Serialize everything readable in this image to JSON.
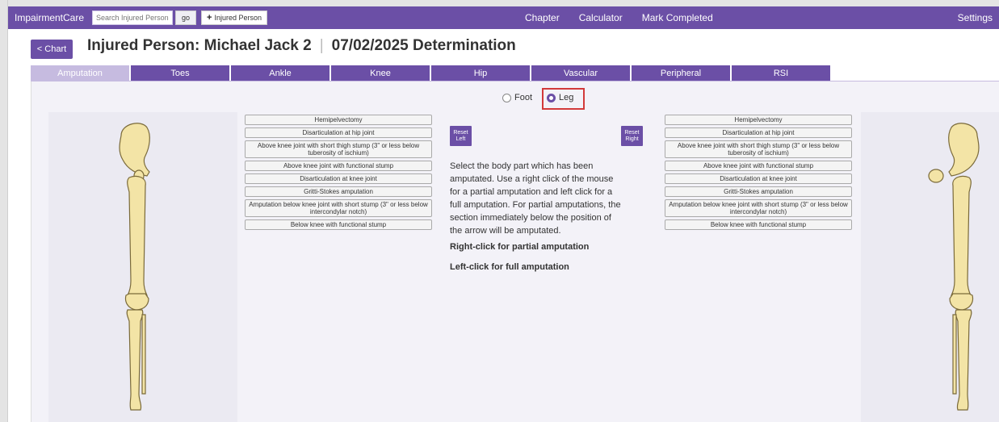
{
  "topbar": {
    "brand": "ImpairmentCare",
    "search_placeholder": "Search Injured Person",
    "go_label": "go",
    "add_label": "Injured Person",
    "nav": [
      "Chapter",
      "Calculator",
      "Mark Completed"
    ],
    "settings": "Settings",
    "color": "#6b4fa6"
  },
  "header": {
    "back_label": "< Chart",
    "person_label": "Injured Person: Michael Jack 2",
    "determination": "07/02/2025 Determination"
  },
  "tabs": [
    {
      "label": "Amputation",
      "active": true
    },
    {
      "label": "Toes",
      "active": false
    },
    {
      "label": "Ankle",
      "active": false
    },
    {
      "label": "Knee",
      "active": false
    },
    {
      "label": "Hip",
      "active": false
    },
    {
      "label": "Vascular",
      "active": false
    },
    {
      "label": "Peripheral",
      "active": false
    },
    {
      "label": "RSI",
      "active": false
    }
  ],
  "selector": {
    "options": [
      "Foot",
      "Leg"
    ],
    "selected": "Leg"
  },
  "amputation_options_left": [
    "Hemipelvectomy",
    "Disarticulation at hip joint",
    "Above knee joint with short thigh stump (3\" or less below tuberosity of ischium)",
    "Above knee joint with functional stump",
    "Disarticulation at knee joint",
    "Gritti-Stokes amputation",
    "Amputation below knee joint with short stump (3\" or less below intercondylar notch)",
    "Below knee with functional stump"
  ],
  "amputation_options_right": [
    "Hemipelvectomy",
    "Disarticulation at hip joint",
    "Above knee joint with short thigh stump (3\" or less below tuberosity of ischium)",
    "Above knee joint with functional stump",
    "Disarticulation at knee joint",
    "Gritti-Stokes amputation",
    "Amputation below knee joint with short stump (3\" or less below intercondylar notch)",
    "Below knee with functional stump"
  ],
  "reset": {
    "left_line1": "Reset",
    "left_line2": "Left",
    "right_line1": "Reset",
    "right_line2": "Right"
  },
  "instructions": {
    "text": "Select the body part which has been amputated. Use a right click of the mouse for a partial amputation and left click for a full amputation. For partial amputations, the section immediately below the position of the arrow will be amputated.",
    "partial": "Right-click for partial amputation",
    "full": "Left-click for full amputation"
  },
  "colors": {
    "accent": "#6b4fa6",
    "tab_active": "#c6bbe0",
    "bone_fill": "#f3e4a6",
    "bone_stroke": "#7a6a3a",
    "highlight": "#d23a3a"
  },
  "icons": {
    "add": "plus-icon",
    "left_leg": "left-leg-bones-icon",
    "right_leg": "right-leg-bones-icon"
  }
}
